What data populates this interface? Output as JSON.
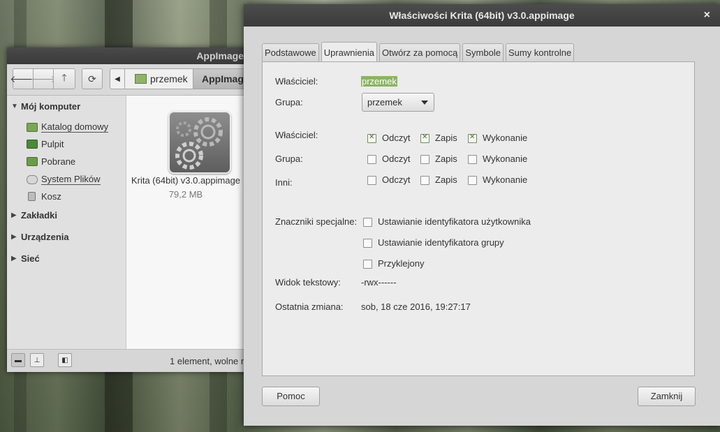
{
  "file_manager": {
    "title": "AppImage",
    "breadcrumb": [
      "przemek",
      "AppImage"
    ],
    "sidebar": {
      "sections": [
        {
          "label": "Mój komputer",
          "expanded": true
        },
        {
          "label": "Zakładki",
          "expanded": false
        },
        {
          "label": "Urządzenia",
          "expanded": false
        },
        {
          "label": "Sieć",
          "expanded": false
        }
      ],
      "items": [
        {
          "label": "Katalog domowy",
          "icon": "home-folder-icon"
        },
        {
          "label": "Pulpit",
          "icon": "desktop-icon"
        },
        {
          "label": "Pobrane",
          "icon": "downloads-icon"
        },
        {
          "label": "System Plików",
          "icon": "drive-icon"
        },
        {
          "label": "Kosz",
          "icon": "trash-icon"
        }
      ]
    },
    "file": {
      "name": "Krita (64bit) v3.0.appimage",
      "size": "79,2 MB"
    },
    "status": "1 element, wolne m"
  },
  "dialog": {
    "title": "Właściwości Krita (64bit) v3.0.appimage",
    "tabs": [
      "Podstawowe",
      "Uprawnienia",
      "Otwórz za pomocą",
      "Symbole",
      "Sumy kontrolne"
    ],
    "active_tab": "Uprawnienia",
    "owner_label": "Właściciel:",
    "owner_value": "przemek",
    "group_label": "Grupa:",
    "group_value": "przemek",
    "permissions": {
      "rows": [
        {
          "label": "Właściciel:",
          "read": true,
          "write": true,
          "exec": true
        },
        {
          "label": "Grupa:",
          "read": false,
          "write": false,
          "exec": false
        },
        {
          "label": "Inni:",
          "read": false,
          "write": false,
          "exec": false
        }
      ],
      "read_label": "Odczyt",
      "write_label": "Zapis",
      "exec_label": "Wykonanie"
    },
    "special_label": "Znaczniki specjalne:",
    "special_flags": [
      {
        "label": "Ustawianie identyfikatora użytkownika",
        "checked": false
      },
      {
        "label": "Ustawianie identyfikatora grupy",
        "checked": false
      },
      {
        "label": "Przyklejony",
        "checked": false
      }
    ],
    "text_view_label": "Widok tekstowy:",
    "text_view_value": "-rwx------",
    "last_change_label": "Ostatnia zmiana:",
    "last_change_value": "sob, 18 cze 2016, 19:27:17",
    "help_button": "Pomoc",
    "close_button": "Zamknij",
    "close_icon": "×"
  }
}
